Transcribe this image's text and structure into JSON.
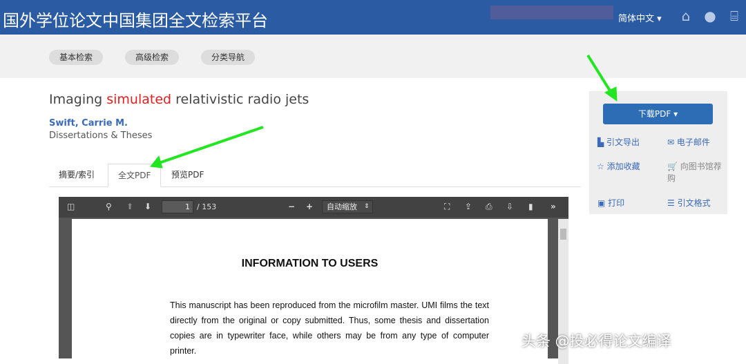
{
  "header": {
    "title": "国外学位论文中国集团全文检索平台",
    "language": "简体中文 ▾",
    "icons": [
      "home-icon",
      "user-icon",
      "library-icon"
    ]
  },
  "nav": {
    "items": [
      "基本检索",
      "高级检索",
      "分类导航"
    ]
  },
  "document": {
    "title_pre": "Imaging ",
    "title_highlight": "simulated",
    "title_post": " relativistic radio jets",
    "author": "Swift, Carrie M.",
    "source": "Dissertations & Theses"
  },
  "tabs": [
    {
      "label": "摘要/索引"
    },
    {
      "label": "全文PDF",
      "active": true
    },
    {
      "label": "预览PDF"
    }
  ],
  "viewer": {
    "page": "1",
    "page_total": "/ 153",
    "zoom": "自动缩放",
    "zoom_arrow": "⇕",
    "page_heading": "INFORMATION TO USERS",
    "page_text": "This manuscript has been reproduced from the microfilm master.  UMI films the text directly from the original or copy submitted.  Thus, some thesis and dissertation copies are in typewriter face, while others may be from any type of computer printer."
  },
  "sidebar": {
    "download": "下载PDF ▾",
    "actions": [
      {
        "label": "引文导出",
        "icon": "file-icon"
      },
      {
        "label": "电子邮件",
        "icon": "envelope-icon"
      },
      {
        "label": "添加收藏",
        "icon": "star-icon"
      },
      {
        "label": "向图书馆荐购",
        "icon": "cart-icon"
      },
      {
        "label": "打印",
        "icon": "print-icon"
      },
      {
        "label": "引文格式",
        "icon": "list-icon"
      }
    ]
  },
  "watermark": "头条 @投必得论文编译",
  "colors": {
    "header": "#2b5ba3",
    "button": "#2d6db5",
    "arrow": "#22e622"
  }
}
